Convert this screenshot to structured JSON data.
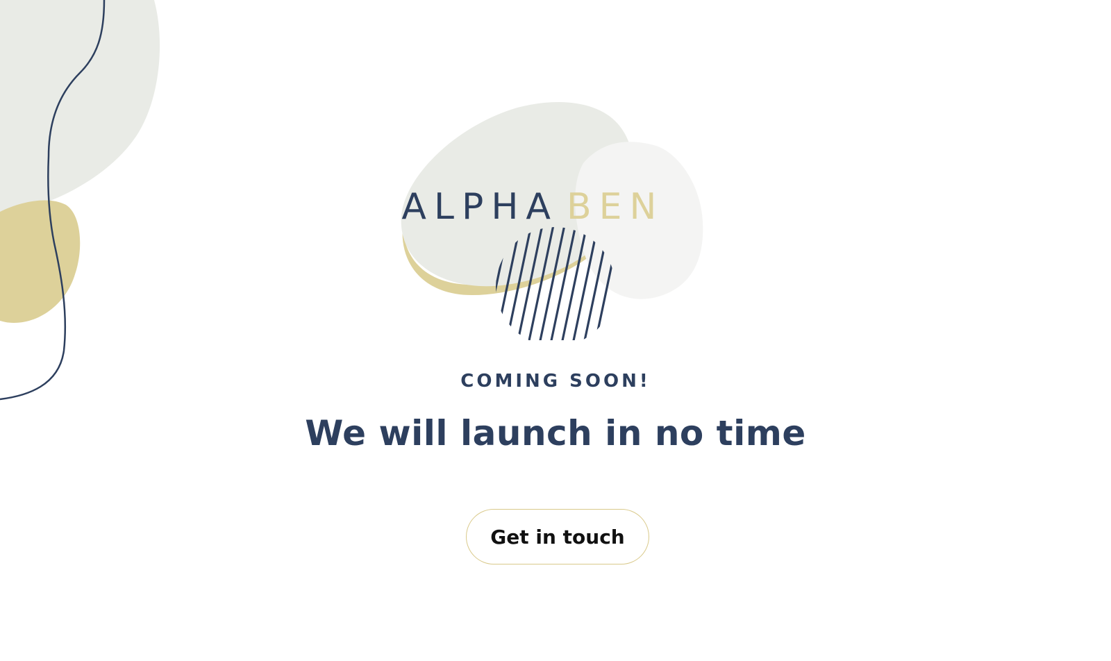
{
  "brand": {
    "name_primary": "ALPHA",
    "name_secondary": "BEN"
  },
  "hero": {
    "eyebrow": "COMING SOON!",
    "headline": "We will launch in no time"
  },
  "cta": {
    "label": "Get in touch"
  },
  "colors": {
    "navy": "#2d3f5e",
    "gold": "#d9c98a",
    "mustard": "#ddd19a",
    "stone": "#e9ebe6",
    "mist": "#f4f4f3",
    "background": "#ffffff"
  },
  "icons": {
    "corner_decoration": "abstract-blob-shapes-icon",
    "logo_mark": "striped-circle-icon"
  }
}
